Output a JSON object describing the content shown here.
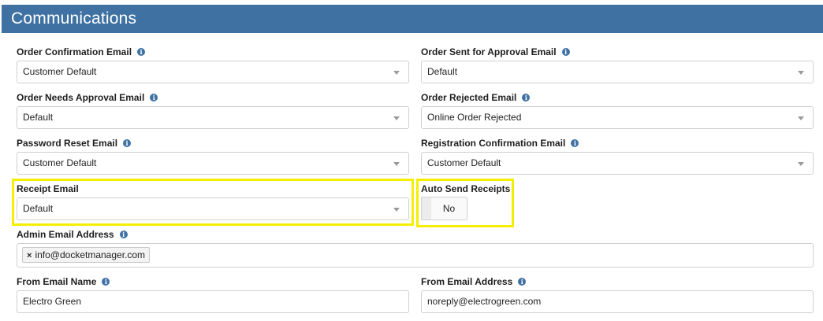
{
  "header": {
    "title": "Communications"
  },
  "fields": {
    "order_confirmation": {
      "label": "Order Confirmation Email",
      "value": "Customer Default"
    },
    "order_sent_approval": {
      "label": "Order Sent for Approval Email",
      "value": "Default"
    },
    "order_needs_approval": {
      "label": "Order Needs Approval Email",
      "value": "Default"
    },
    "order_rejected": {
      "label": "Order Rejected Email",
      "value": "Online Order Rejected"
    },
    "password_reset": {
      "label": "Password Reset Email",
      "value": "Customer Default"
    },
    "registration_confirmation": {
      "label": "Registration Confirmation Email",
      "value": "Customer Default"
    },
    "receipt": {
      "label": "Receipt Email",
      "value": "Default"
    },
    "auto_send_receipts": {
      "label": "Auto Send Receipts",
      "value": "No"
    },
    "admin_email": {
      "label": "Admin Email Address",
      "tags": [
        "info@docketmanager.com"
      ],
      "remove_symbol": "×"
    },
    "from_name": {
      "label": "From Email Name",
      "value": "Electro Green"
    },
    "from_address": {
      "label": "From Email Address",
      "value": "noreply@electrogreen.com"
    }
  },
  "icons": {
    "info": "info-icon",
    "dropdown": "chevron-down-icon"
  },
  "colors": {
    "header_bg": "#3f72a3",
    "highlight": "#f5ee00",
    "info_icon": "#3f72a3"
  }
}
